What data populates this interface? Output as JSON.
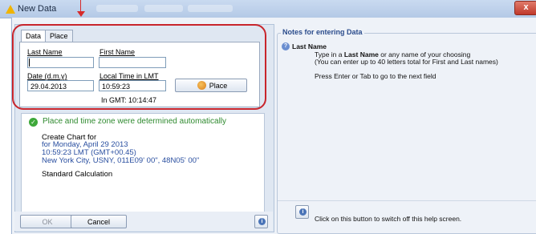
{
  "window": {
    "title": "New Data",
    "close_glyph": "x",
    "accent_color": "#c8252c"
  },
  "tabs": [
    {
      "label": "Data",
      "active": true
    },
    {
      "label": "Place",
      "active": false
    }
  ],
  "form": {
    "last_name_label": "Last Name",
    "first_name_label": "First Name",
    "last_name_value": "",
    "first_name_value": "",
    "date_label": "Date (d.m.y)",
    "local_time_label": "Local Time in LMT",
    "date_value": "29.04.2013",
    "local_time_value": "10:59:23",
    "place_button_label": "Place",
    "gmt_text": "In GMT: 10:14:47"
  },
  "status": {
    "headline": "Place and time zone were determined automatically",
    "create_chart": "Create Chart for",
    "date_line": "for Monday, April 29  2013",
    "time_line": "10:59:23 LMT (GMT+00.45)",
    "location_line": "New York City, USNY, 011E09' 00\", 48N05' 00\"",
    "calc": "Standard Calculation"
  },
  "buttons": {
    "ok": "OK",
    "cancel": "Cancel"
  },
  "notes": {
    "title": "Notes for entering Data",
    "heading": "Last Name",
    "line1_pre": "Type in a ",
    "line1_bold": "Last Name",
    "line1_post": " or any name of your choosing",
    "line2": "(You can enter up to 40 letters total for First and Last names)",
    "line3": "Press Enter or Tab to go to the next field",
    "footer": "Click on this button to switch off this help screen."
  },
  "icons": {
    "title": "warning-triangle-icon",
    "check": "check-circle-icon",
    "help": "help-info-icon",
    "question": "question-circle-icon",
    "place": "globe-icon"
  }
}
